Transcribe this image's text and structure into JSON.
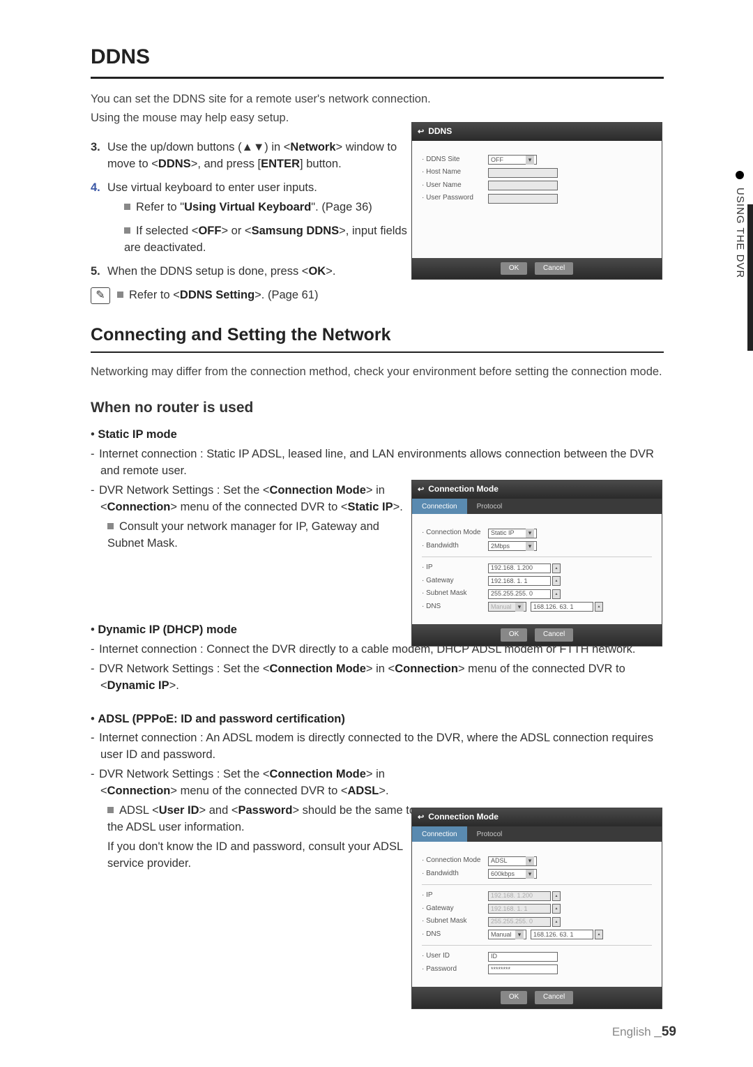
{
  "sidebar": {
    "label": "USING THE DVR"
  },
  "h1": "DDNS",
  "intro1": "You can set the DDNS site for a remote user's network connection.",
  "intro2": "Using the mouse may help easy setup.",
  "step3": {
    "num": "3.",
    "pre": "Use the up/down buttons (▲▼) in <",
    "b1": "Network",
    "mid1": "> window to move to <",
    "b2": "DDNS",
    "mid2": ">, and press [",
    "b3": "ENTER",
    "post": "] button."
  },
  "step4": {
    "num": "4.",
    "text": "Use virtual keyboard to enter user inputs.",
    "sub1_pre": "Refer to \"",
    "sub1_b": "Using Virtual Keyboard",
    "sub1_post": "\". (Page 36)",
    "sub2_pre": "If selected <",
    "sub2_b1": "OFF",
    "sub2_mid": "> or <",
    "sub2_b2": "Samsung DDNS",
    "sub2_post": ">, input fields are deactivated."
  },
  "step5": {
    "num": "5.",
    "pre": "When the DDNS setup is done, press <",
    "b1": "OK",
    "post": ">."
  },
  "note1": {
    "pre": "Refer to <",
    "b": "DDNS Setting",
    "post": ">. (Page 61)"
  },
  "h2": "Connecting and Setting the Network",
  "netIntro": "Networking may differ from the connection method, check your environment before setting the connection mode.",
  "h3": "When no router is used",
  "static": {
    "title": "Static IP mode",
    "line1": "Internet connection : Static IP ADSL, leased line, and LAN environments allows connection between the DVR and remote user.",
    "line2_pre": "DVR Network Settings : Set the <",
    "line2_b1": "Connection Mode",
    "line2_mid": "> in <",
    "line2_b2": "Connection",
    "line2_mid2": "> menu of the connected DVR to <",
    "line2_b3": "Static IP",
    "line2_post": ">.",
    "sub": "Consult your network manager for IP, Gateway and Subnet Mask."
  },
  "dhcp": {
    "title": "Dynamic IP (DHCP) mode",
    "line1": "Internet connection : Connect the DVR directly to a cable modem, DHCP ADSL modem or FTTH network.",
    "line2_pre": "DVR Network Settings : Set the <",
    "line2_b1": "Connection Mode",
    "line2_mid1": "> in <",
    "line2_b2": "Connection",
    "line2_mid2": "> menu of the connected DVR to <",
    "line2_b3": "Dynamic IP",
    "line2_post": ">."
  },
  "adsl": {
    "title": "ADSL (PPPoE: ID and password certification)",
    "line1": "Internet connection : An ADSL modem is directly connected to the DVR, where the ADSL connection requires user ID and password.",
    "line2_pre": "DVR Network Settings : Set the <",
    "line2_b1": "Connection Mode",
    "line2_mid": "> in <",
    "line2_b2": "Connection",
    "line2_mid2": "> menu of the connected DVR to <",
    "line2_b3": "ADSL",
    "line2_post": ">.",
    "sub_pre": "ADSL <",
    "sub_b1": "User ID",
    "sub_mid": "> and <",
    "sub_b2": "Password",
    "sub_post": "> should be the same to the ADSL user information.",
    "sub2": "If you don't know the ID and password, consult your ADSL service provider."
  },
  "fig1": {
    "title": "DDNS",
    "rows": {
      "site_l": "· DDNS Site",
      "site_v": "OFF",
      "host_l": "· Host Name",
      "user_l": "· User Name",
      "pass_l": "· User Password"
    },
    "ok": "OK",
    "cancel": "Cancel"
  },
  "fig2": {
    "title": "Connection Mode",
    "tab1": "Connection",
    "tab2": "Protocol",
    "cm_l": "· Connection Mode",
    "cm_v": "Static IP",
    "bw_l": "· Bandwidth",
    "bw_v": "2Mbps",
    "ip_l": "· IP",
    "ip_v": "192.168. 1.200",
    "gw_l": "· Gateway",
    "gw_v": "192.168. 1. 1",
    "sm_l": "· Subnet Mask",
    "sm_v": "255.255.255. 0",
    "dns_l": "· DNS",
    "dns_m": "Manual",
    "dns_v": "168.126. 63. 1",
    "ok": "OK",
    "cancel": "Cancel"
  },
  "fig3": {
    "title": "Connection Mode",
    "tab1": "Connection",
    "tab2": "Protocol",
    "cm_l": "· Connection Mode",
    "cm_v": "ADSL",
    "bw_l": "· Bandwidth",
    "bw_v": "600kbps",
    "ip_l": "· IP",
    "ip_v": "192.168. 1.200",
    "gw_l": "· Gateway",
    "gw_v": "192.168. 1. 1",
    "sm_l": "· Subnet Mask",
    "sm_v": "255.255.255. 0",
    "dns_l": "· DNS",
    "dns_m": "Manual",
    "dns_v": "168.126. 63. 1",
    "uid_l": "· User ID",
    "uid_v": "ID",
    "pw_l": "· Password",
    "pw_v": "********",
    "ok": "OK",
    "cancel": "Cancel"
  },
  "footer": {
    "lang": "English ",
    "page": "_59"
  }
}
